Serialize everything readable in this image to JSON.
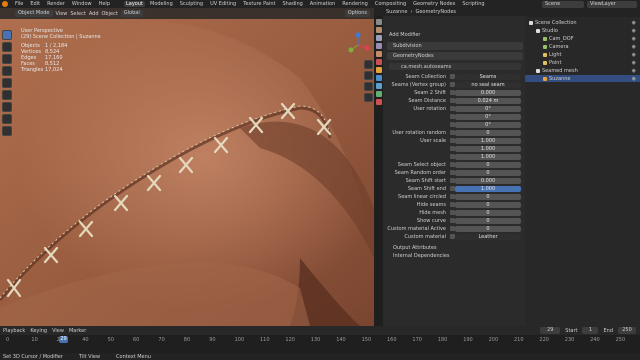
{
  "menu": {
    "items": [
      "File",
      "Edit",
      "Render",
      "Window",
      "Help"
    ],
    "workspaces": [
      "Layout",
      "Modeling",
      "Sculpting",
      "UV Editing",
      "Texture Paint",
      "Shading",
      "Animation",
      "Rendering",
      "Compositing",
      "Geometry Nodes",
      "Scripting"
    ],
    "scene": "Scene",
    "view_layer": "ViewLayer"
  },
  "viewport": {
    "mode": "Object Mode",
    "menus": [
      "View",
      "Select",
      "Add",
      "Object"
    ],
    "orientation": "Global",
    "options": "Options",
    "title": "User Perspective",
    "subtitle": "(29) Scene Collection | Suzanne",
    "stats": [
      {
        "k": "Objects",
        "v": "1 / 2,184"
      },
      {
        "k": "Vertices",
        "v": "8,524"
      },
      {
        "k": "Edges",
        "v": "17,160"
      },
      {
        "k": "Faces",
        "v": "8,512"
      },
      {
        "k": "Triangles",
        "v": "17,024"
      }
    ]
  },
  "properties": {
    "breadcrumb_obj": "Suzanne",
    "breadcrumb_mod": "GeometryNodes",
    "add_modifier": "Add Modifier",
    "modifiers": [
      "Subdivision",
      "GeometryNodes"
    ],
    "group": "ca.mesh.autoseams",
    "rows": [
      {
        "l": "Seam Collection",
        "v": "Seams",
        "t": "dark"
      },
      {
        "l": "Seams (Vertex group)",
        "v": "no seal seam",
        "t": "dark"
      },
      {
        "l": "Seam 2 Shift",
        "v": "0.000",
        "t": "f"
      },
      {
        "l": "Seam Distance",
        "v": "0.024 m",
        "t": "f"
      },
      {
        "l": "User rotation",
        "v": "0°",
        "t": "f"
      },
      {
        "l": "",
        "v": "0°",
        "t": "f"
      },
      {
        "l": "",
        "v": "0°",
        "t": "f"
      },
      {
        "l": "User rotation random",
        "v": "0",
        "t": "f"
      },
      {
        "l": "User scale",
        "v": "1.000",
        "t": "f"
      },
      {
        "l": "",
        "v": "1.000",
        "t": "f"
      },
      {
        "l": "",
        "v": "1.000",
        "t": "f"
      },
      {
        "l": "Seam Select object",
        "v": "0",
        "t": "f"
      },
      {
        "l": "Seam Random order",
        "v": "0",
        "t": "f"
      },
      {
        "l": "Seam Shift start",
        "v": "0.000",
        "t": "f"
      },
      {
        "l": "Seam Shift end",
        "v": "1.000",
        "t": "blue"
      },
      {
        "l": "Seam linear circled",
        "v": "0",
        "t": "f"
      },
      {
        "l": "Hide seams",
        "v": "0",
        "t": "f"
      },
      {
        "l": "Hide mesh",
        "v": "0",
        "t": "f"
      },
      {
        "l": "Show curve",
        "v": "0",
        "t": "f"
      },
      {
        "l": "Custom material Active",
        "v": "0",
        "t": "f"
      },
      {
        "l": "Custom material",
        "v": "Leather",
        "t": "dark"
      }
    ],
    "sections": [
      "Output Attributes",
      "Internal Dependencies"
    ]
  },
  "outliner": {
    "items": [
      {
        "n": "Scene Collection",
        "d": 0,
        "c": "#dddddd"
      },
      {
        "n": "Studio",
        "d": 1,
        "c": "#e0e0e0"
      },
      {
        "n": "Cam_DOF",
        "d": 2,
        "c": "#98c26a"
      },
      {
        "n": "Camera",
        "d": 2,
        "c": "#98c26a"
      },
      {
        "n": "Light",
        "d": 2,
        "c": "#e0c060"
      },
      {
        "n": "Point",
        "d": 2,
        "c": "#e0c060"
      },
      {
        "n": "Seamed mesh",
        "d": 1,
        "c": "#e0e0e0"
      },
      {
        "n": "Suzanne",
        "d": 2,
        "c": "#e8a23a"
      }
    ]
  },
  "timeline": {
    "menus": [
      "Playback",
      "Keying",
      "View",
      "Marker"
    ],
    "current": "29",
    "start_label": "Start",
    "start": "1",
    "end_label": "End",
    "end": "250",
    "ticks": [
      "0",
      "10",
      "20",
      "40",
      "50",
      "60",
      "70",
      "80",
      "90",
      "100",
      "110",
      "120",
      "130",
      "140",
      "150",
      "160",
      "170",
      "180",
      "190",
      "200",
      "210",
      "220",
      "230",
      "240",
      "250"
    ]
  },
  "status": {
    "items": [
      "Set 3D Cursor / Modifier",
      "Tilt View",
      "Context Menu"
    ]
  }
}
